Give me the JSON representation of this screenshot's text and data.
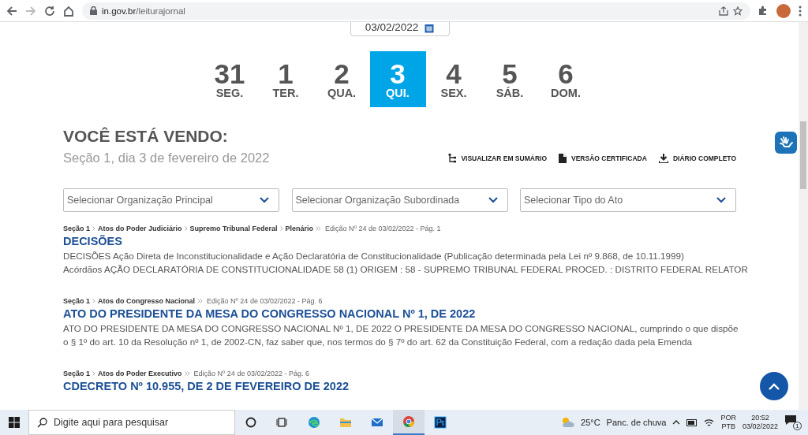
{
  "browser": {
    "url_host": "in.gov.br",
    "url_path": "/leiturajornal"
  },
  "date_field": {
    "value": "03/02/2022"
  },
  "days": [
    {
      "number": "31",
      "weekday": "SEG.",
      "selected": false
    },
    {
      "number": "1",
      "weekday": "TER.",
      "selected": false
    },
    {
      "number": "2",
      "weekday": "QUA.",
      "selected": false
    },
    {
      "number": "3",
      "weekday": "QUI.",
      "selected": true
    },
    {
      "number": "4",
      "weekday": "SEX.",
      "selected": false
    },
    {
      "number": "5",
      "weekday": "SÁB.",
      "selected": false
    },
    {
      "number": "6",
      "weekday": "DOM.",
      "selected": false
    }
  ],
  "heading": "VOCÊ ESTÁ VENDO:",
  "subtitle": "Seção 1, dia 3 de fevereiro de 2022",
  "actions": [
    {
      "kind": "tree",
      "label": "VISUALIZAR EM SUMÁRIO"
    },
    {
      "kind": "file",
      "label": "VERSÃO CERTIFICADA"
    },
    {
      "kind": "download",
      "label": "DIÁRIO COMPLETO"
    }
  ],
  "filters": [
    {
      "placeholder": "Selecionar Organização Principal"
    },
    {
      "placeholder": "Selecionar Organização Subordinada"
    },
    {
      "placeholder": "Selecionar Tipo do Ato"
    }
  ],
  "results": [
    {
      "breadcrumb": [
        "Seção 1",
        "Atos do Poder Judiciário",
        "Supremo Tribunal Federal",
        "Plenário"
      ],
      "edition": "Edição Nº 24 de 03/02/2022 - Pág. 1",
      "title": "DECISÕES",
      "lines": [
        "DECISÕES Ação Direta de Inconstitucionalidade e Ação Declaratória de Constitucionalidade (Publicação determinada pela Lei nº 9.868, de 10.11.1999)",
        "Acórdãos AÇÃO DECLARATÓRIA DE CONSTITUCIONALIDADE 58 (1) ORIGEM : 58 - SUPREMO TRIBUNAL FEDERAL PROCED. : DISTRITO FEDERAL RELATOR"
      ]
    },
    {
      "breadcrumb": [
        "Seção 1",
        "Atos do Congresso Nacional"
      ],
      "edition": "Edição Nº 24 de 03/02/2022 - Pág. 6",
      "title": "ATO DO PRESIDENTE DA MESA DO CONGRESSO NACIONAL Nº 1, DE 2022",
      "lines": [
        "ATO DO PRESIDENTE DA MESA DO CONGRESSO NACIONAL Nº 1, DE 2022 O PRESIDENTE DA MESA DO CONGRESSO NACIONAL, cumprindo o que dispõe",
        "o § 1º do art. 10 da Resolução nº 1, de 2002-CN, faz saber que, nos termos do § 7º do art. 62 da Constituição Federal, com a redação dada pela Emenda"
      ]
    },
    {
      "breadcrumb": [
        "Seção 1",
        "Atos do Poder Executivo"
      ],
      "edition": "Edição Nº 24 de 03/02/2022 - Pág. 6",
      "title": "CDECRETO Nº 10.955, DE 2 DE FEVEREIRO DE 2022"
    }
  ],
  "taskbar": {
    "search_placeholder": "Digite aqui para pesquisar",
    "temperature": "25°C",
    "weather": "Panc. de chuva",
    "language": "POR",
    "layout": "PTB",
    "time": "20:52",
    "date": "03/02/2022",
    "notifications": "1"
  }
}
